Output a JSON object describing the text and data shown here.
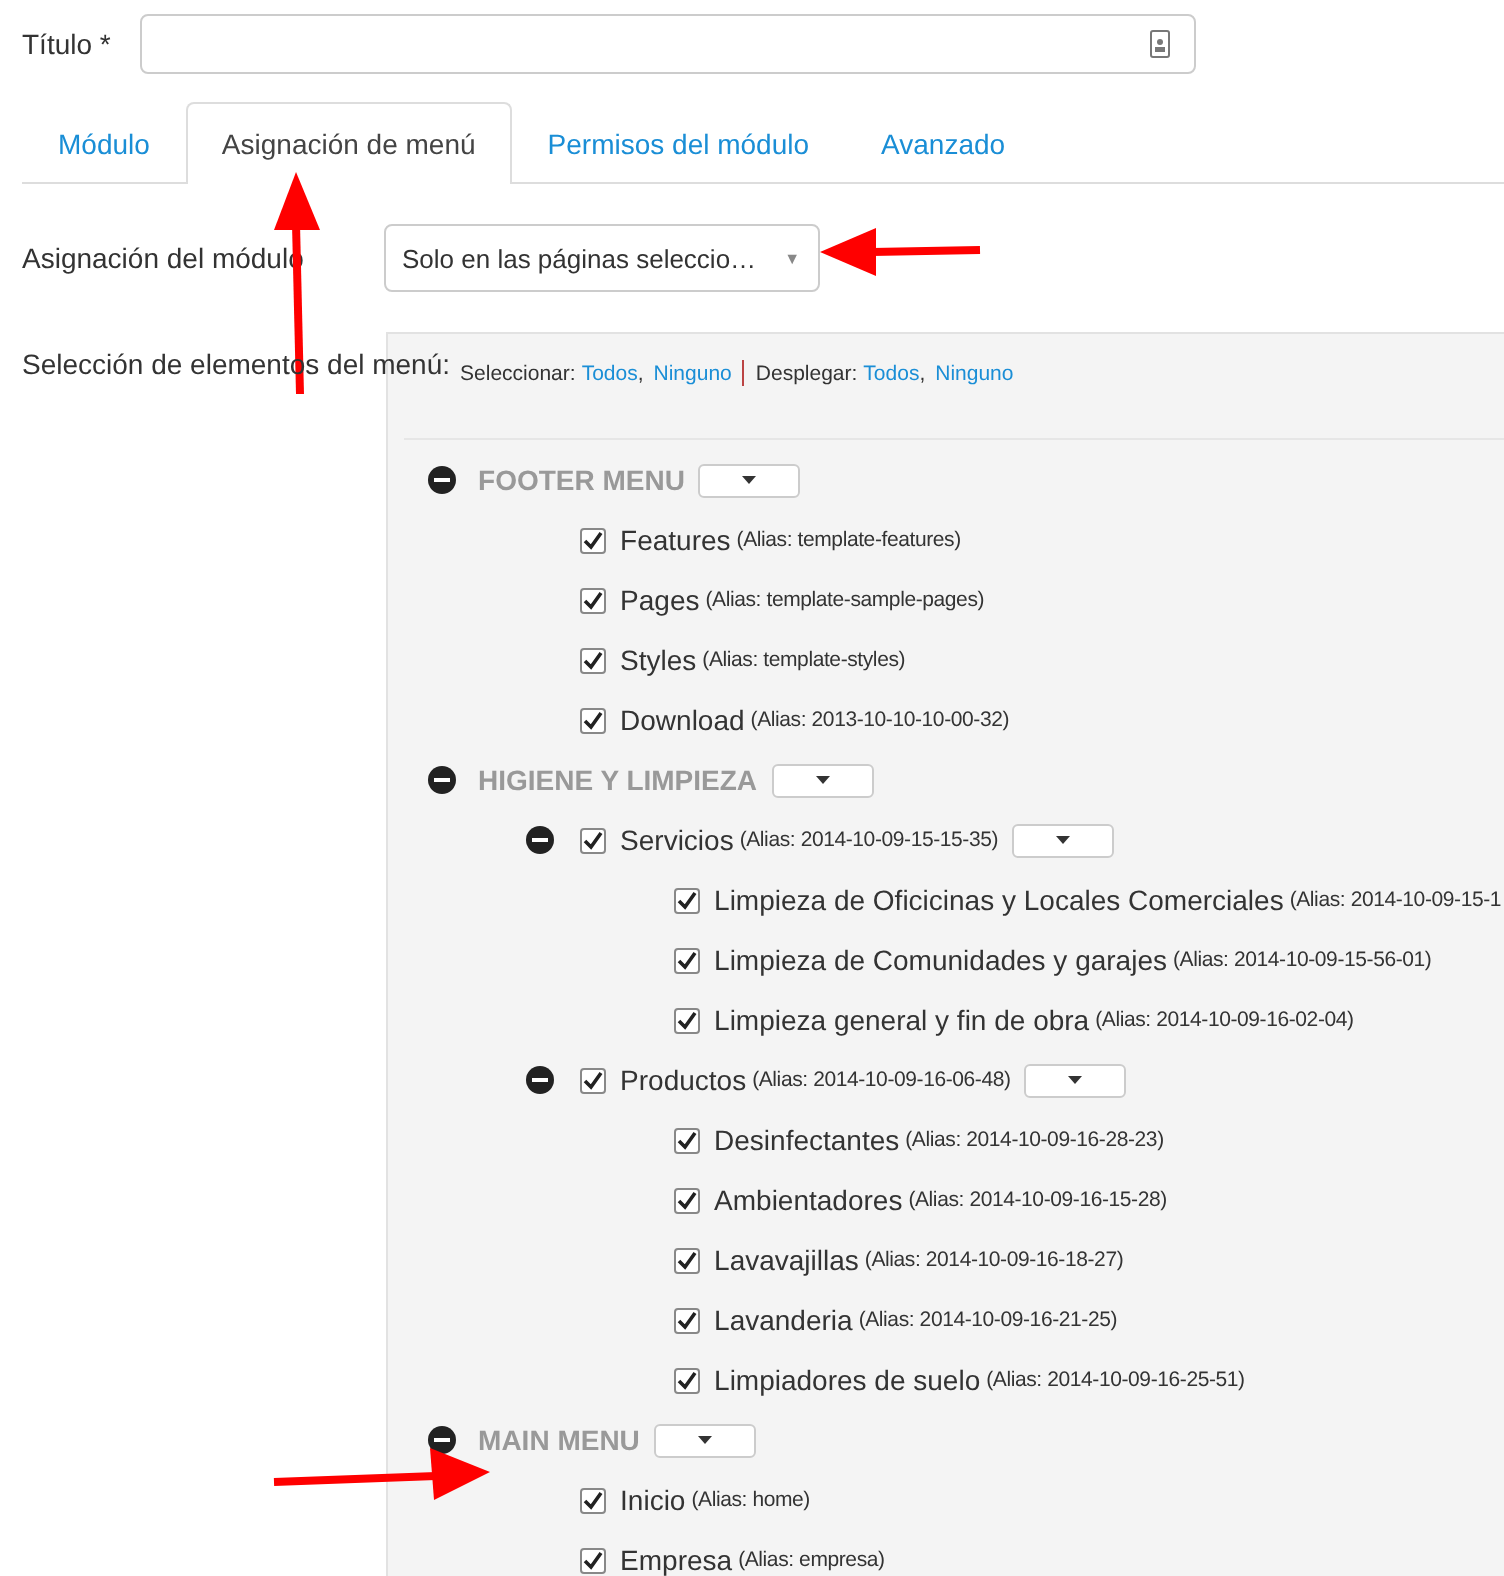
{
  "title_field": {
    "label": "Título *"
  },
  "tabs": [
    {
      "label": "Módulo",
      "selected": false
    },
    {
      "label": "Asignación de menú",
      "selected": true
    },
    {
      "label": "Permisos del módulo",
      "selected": false
    },
    {
      "label": "Avanzado",
      "selected": false
    }
  ],
  "module_assignment": {
    "label": "Asignación del módulo",
    "value": "Solo en las páginas seleccio…",
    "caret": "▼"
  },
  "menu_selection": {
    "label": "Selección de elementos del menú:",
    "toolbar": {
      "select_label": "Seleccionar:",
      "select_links": [
        "Todos",
        "Ninguno"
      ],
      "expand_label": "Desplegar:",
      "expand_links": [
        "Todos",
        "Ninguno"
      ],
      "separator": ","
    },
    "menus": [
      {
        "title": "FOOTER MENU",
        "expanded": true,
        "items": [
          {
            "title": "Features",
            "alias": "(Alias: template-features)",
            "checked": true
          },
          {
            "title": "Pages",
            "alias": "(Alias: template-sample-pages)",
            "checked": true
          },
          {
            "title": "Styles",
            "alias": "(Alias: template-styles)",
            "checked": true
          },
          {
            "title": "Download",
            "alias": "(Alias: 2013-10-10-10-00-32)",
            "checked": true
          }
        ]
      },
      {
        "title": "HIGIENE Y LIMPIEZA",
        "expanded": true,
        "items": [
          {
            "title": "Servicios",
            "alias": "(Alias: 2014-10-09-15-15-35)",
            "checked": true,
            "expanded": true,
            "children": [
              {
                "title": "Limpieza de Oficicinas y Locales Comerciales",
                "alias": "(Alias: 2014-10-09-15-1",
                "checked": true
              },
              {
                "title": "Limpieza de Comunidades y garajes",
                "alias": "(Alias: 2014-10-09-15-56-01)",
                "checked": true
              },
              {
                "title": "Limpieza general y fin de obra",
                "alias": "(Alias: 2014-10-09-16-02-04)",
                "checked": true
              }
            ]
          },
          {
            "title": "Productos",
            "alias": "(Alias: 2014-10-09-16-06-48)",
            "checked": true,
            "expanded": true,
            "children": [
              {
                "title": "Desinfectantes",
                "alias": "(Alias: 2014-10-09-16-28-23)",
                "checked": true
              },
              {
                "title": "Ambientadores",
                "alias": "(Alias: 2014-10-09-16-15-28)",
                "checked": true
              },
              {
                "title": "Lavavajillas",
                "alias": "(Alias: 2014-10-09-16-18-27)",
                "checked": true
              },
              {
                "title": "Lavanderia",
                "alias": "(Alias: 2014-10-09-16-21-25)",
                "checked": true
              },
              {
                "title": "Limpiadores de suelo",
                "alias": "(Alias: 2014-10-09-16-25-51)",
                "checked": true
              }
            ]
          }
        ]
      },
      {
        "title": "MAIN MENU",
        "expanded": true,
        "items": [
          {
            "title": "Inicio",
            "alias": "(Alias: home)",
            "checked": true
          },
          {
            "title": "Empresa",
            "alias": "(Alias: empresa)",
            "checked": true
          }
        ]
      }
    ]
  }
}
